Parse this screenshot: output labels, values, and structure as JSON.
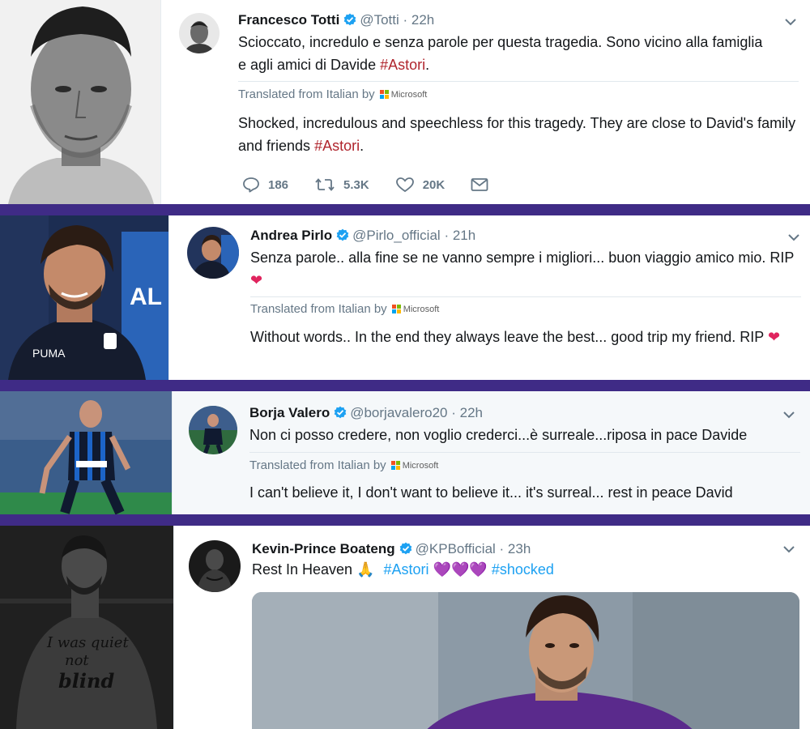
{
  "tweets": [
    {
      "name": "Francesco Totti",
      "handle": "@Totti",
      "time": "· 22h",
      "text": "Scioccato, incredulo e senza parole per questa tragedia. Sono vicino alla famiglia e agli amici di Davide",
      "hashtag": "#Astori",
      "trailing": ".",
      "translated_from": "Translated from Italian by",
      "translator": "Microsoft",
      "translation": "Shocked, incredulous and speechless for this tragedy. They are close to David's family and friends",
      "translation_hashtag": "#Astori",
      "translation_trailing": ".",
      "replies": "186",
      "retweets": "5.3K",
      "likes": "20K"
    },
    {
      "name": "Andrea Pirlo",
      "handle": "@Pirlo_official",
      "time": "· 21h",
      "text": "Senza parole.. alla fine se ne vanno sempre i migliori... buon viaggio amico mio. RIP",
      "emoji": "❤",
      "translated_from": "Translated from Italian by",
      "translator": "Microsoft",
      "translation": "Without words.. In the end they always leave the best... good trip my friend. RIP",
      "translation_emoji": "❤"
    },
    {
      "name": "Borja Valero",
      "handle": "@borjavalero20",
      "time": "· 22h",
      "text": "Non ci posso credere, non voglio crederci...è surreale...riposa in pace Davide",
      "translated_from": "Translated from Italian by",
      "translator": "Microsoft",
      "translation": "I can't believe it, I don't want to believe it... it's surreal... rest in peace David"
    },
    {
      "name": "Kevin-Prince Boateng",
      "handle": "@KPBofficial",
      "time": "· 23h",
      "text": "Rest In Heaven",
      "pray_emoji": "🙏",
      "hashtag1": "#Astori",
      "hearts": "💜💜💜",
      "hashtag2": "#shocked"
    }
  ],
  "tattoo_text": [
    "I was quiet",
    "not",
    "blind"
  ],
  "colors": {
    "divider": "#3f2b86",
    "verified": "#1da1f2",
    "hashtag_red": "#b0252d",
    "hashtag_blue": "#1da1f2"
  },
  "icons": [
    "reply-icon",
    "retweet-icon",
    "like-icon",
    "message-icon",
    "verified-icon",
    "chevron-down-icon",
    "microsoft-logo"
  ]
}
